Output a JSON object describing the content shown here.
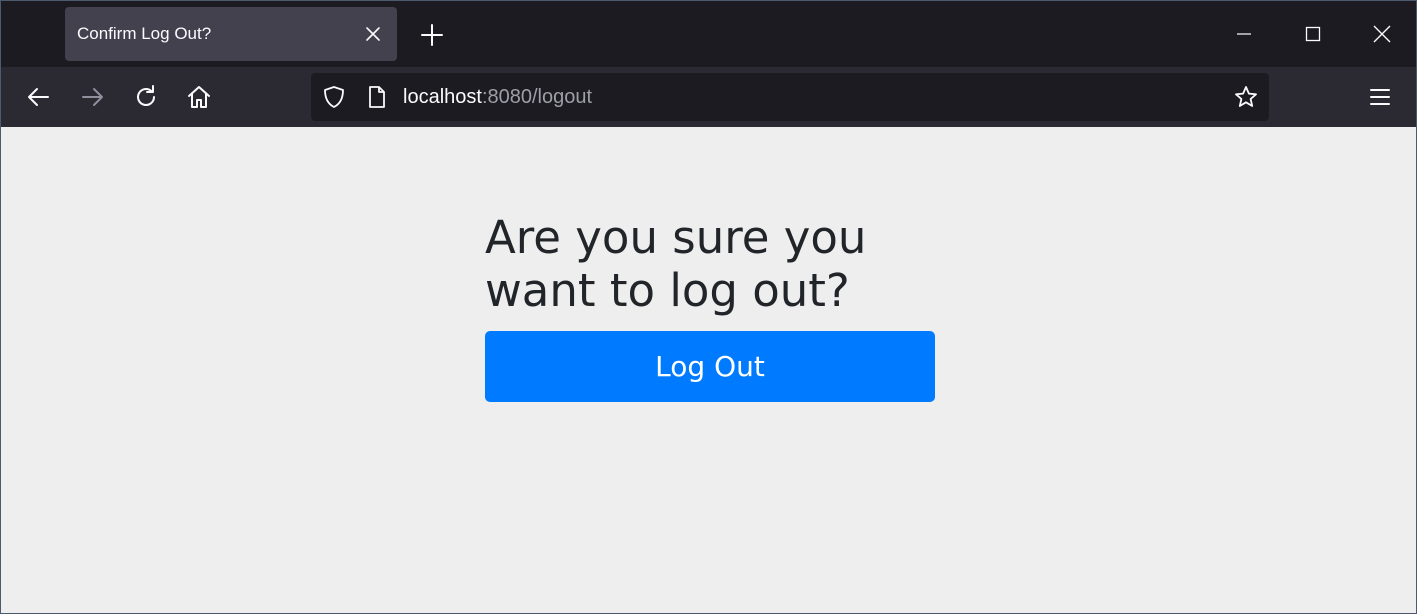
{
  "browser": {
    "tab": {
      "title": "Confirm Log Out?"
    },
    "address": {
      "host": "localhost",
      "rest": ":8080/logout"
    }
  },
  "page": {
    "heading": "Are you sure you want to log out?",
    "logout_button_label": "Log Out"
  },
  "colors": {
    "primary": "#007bff",
    "page_bg": "#eeeeee",
    "chrome_dark": "#1c1b22",
    "toolbar": "#2b2a33",
    "text": "#212529"
  },
  "icons": {
    "tab_close": "close-icon",
    "new_tab": "plus-icon",
    "back": "arrow-left-icon",
    "forward": "arrow-right-icon",
    "reload": "reload-icon",
    "home": "home-icon",
    "shield": "shield-icon",
    "page": "page-icon",
    "bookmark": "star-icon",
    "menu": "hamburger-menu-icon",
    "minimize": "minimize-icon",
    "maximize": "maximize-icon",
    "close_window": "close-window-icon"
  }
}
